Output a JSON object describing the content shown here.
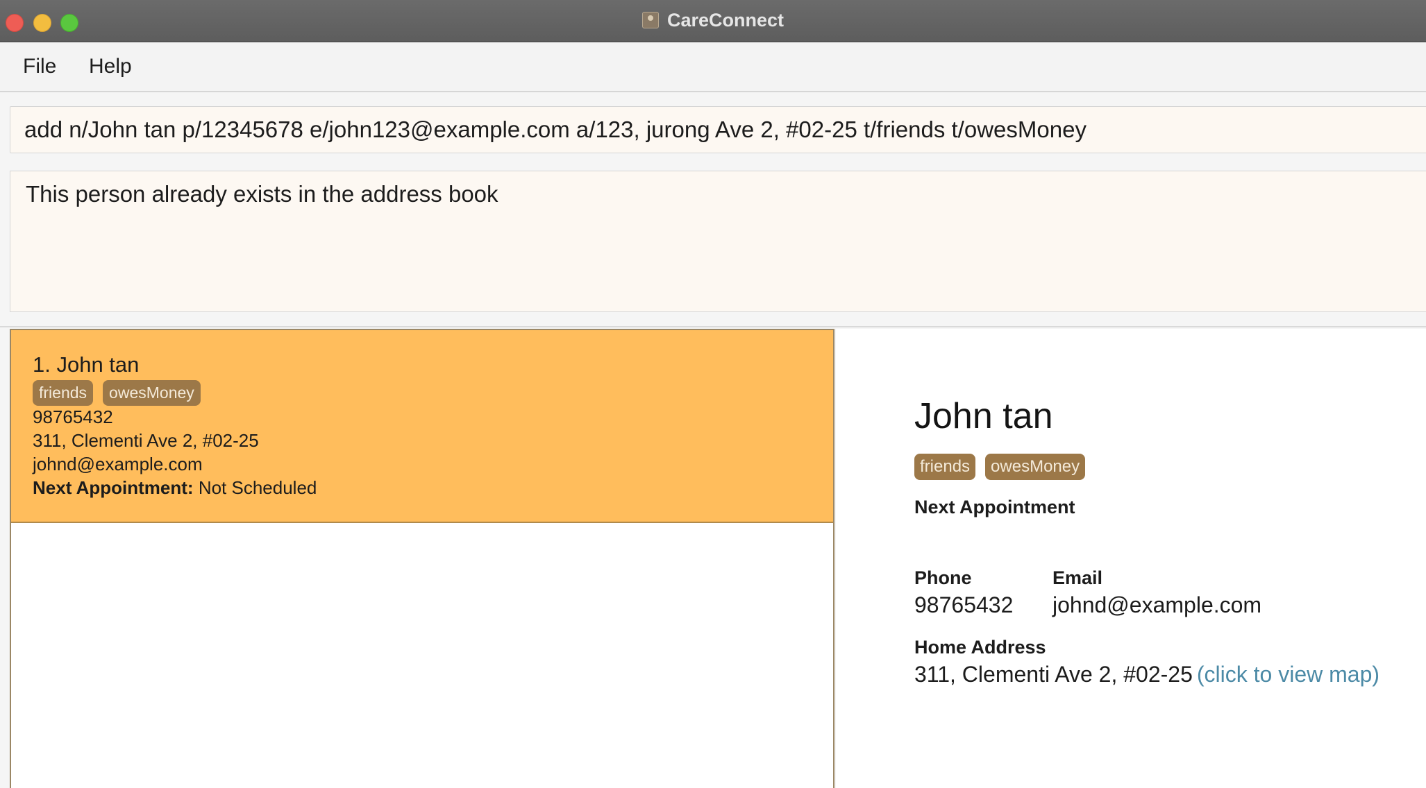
{
  "window": {
    "title": "CareConnect"
  },
  "menu": {
    "file": "File",
    "help": "Help"
  },
  "command": {
    "value": "add n/John tan p/12345678 e/john123@example.com a/123, jurong Ave 2, #02-25 t/friends t/owesMoney"
  },
  "result": {
    "message": "This person already exists in the address book"
  },
  "person_list": [
    {
      "index_name": "1. John tan",
      "tags": [
        "friends",
        "owesMoney"
      ],
      "phone": "98765432",
      "address": "311, Clementi Ave 2, #02-25",
      "email": "johnd@example.com",
      "appointment_label": "Next Appointment:",
      "appointment_value": "Not Scheduled"
    }
  ],
  "detail": {
    "name": "John tan",
    "tags": [
      "friends",
      "owesMoney"
    ],
    "appointment_label": "Next Appointment",
    "phone_label": "Phone",
    "phone": "98765432",
    "email_label": "Email",
    "email": "johnd@example.com",
    "address_label": "Home Address",
    "address": "311, Clementi Ave 2, #02-25",
    "map_link": "(click to view map)"
  },
  "colors": {
    "selected_card": "#ffbd5c",
    "tag_bg": "#9c7848",
    "link": "#4c8aa6",
    "input_bg": "#fdf8f2"
  }
}
